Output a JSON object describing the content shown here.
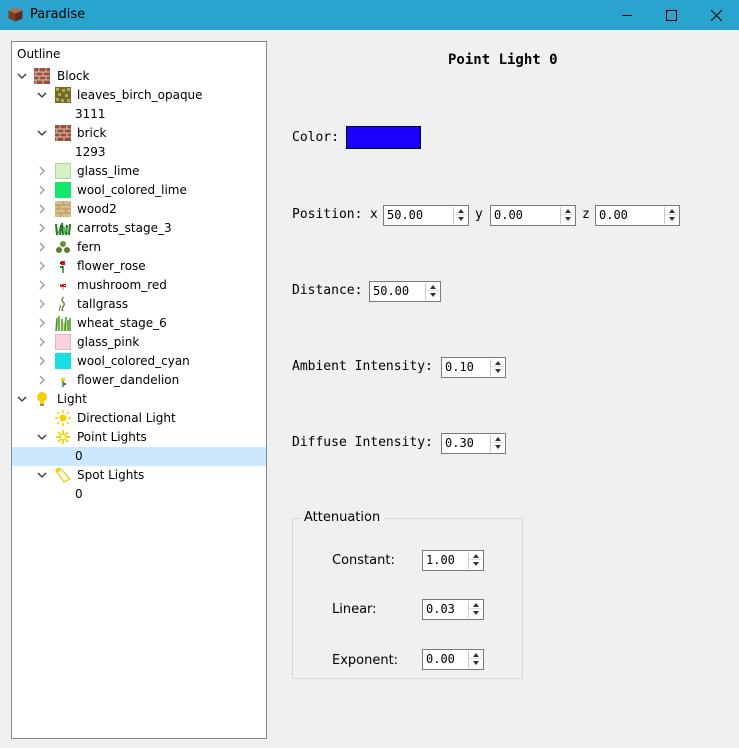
{
  "window": {
    "title": "Paradise"
  },
  "tree": {
    "header": "Outline",
    "rows": [
      {
        "label": "Block",
        "expanded": true,
        "icon": "brick-icon"
      },
      {
        "label": "leaves_birch_opaque",
        "expanded": true,
        "icon": "leaves-icon"
      },
      {
        "label": "3111"
      },
      {
        "label": "brick",
        "expanded": true,
        "icon": "brick-icon"
      },
      {
        "label": "1293"
      },
      {
        "label": "glass_lime",
        "expanded": false,
        "icon": "glass-lime-icon",
        "color": "#d9f0c2"
      },
      {
        "label": "wool_colored_lime",
        "expanded": false,
        "icon": "wool-lime-icon",
        "color": "#11e86a"
      },
      {
        "label": "wood2",
        "expanded": false,
        "icon": "wood-icon"
      },
      {
        "label": "carrots_stage_3",
        "expanded": false,
        "icon": "carrots-icon"
      },
      {
        "label": "fern",
        "expanded": false,
        "icon": "fern-icon"
      },
      {
        "label": "flower_rose",
        "expanded": false,
        "icon": "rose-icon"
      },
      {
        "label": "mushroom_red",
        "expanded": false,
        "icon": "mushroom-icon"
      },
      {
        "label": "tallgrass",
        "expanded": false,
        "icon": "tallgrass-icon"
      },
      {
        "label": "wheat_stage_6",
        "expanded": false,
        "icon": "wheat-icon"
      },
      {
        "label": "glass_pink",
        "expanded": false,
        "icon": "glass-pink-icon",
        "color": "#f9d2de"
      },
      {
        "label": "wool_colored_cyan",
        "expanded": false,
        "icon": "wool-cyan-icon",
        "color": "#16dfe5"
      },
      {
        "label": "flower_dandelion",
        "expanded": false,
        "icon": "dandelion-icon"
      },
      {
        "label": "Light",
        "expanded": true,
        "icon": "lightbulb-icon"
      },
      {
        "label": "Directional Light",
        "icon": "sun-icon"
      },
      {
        "label": "Point Lights",
        "expanded": true,
        "icon": "point-light-icon"
      },
      {
        "label": "0",
        "selected": true
      },
      {
        "label": "Spot Lights",
        "expanded": true,
        "icon": "spotlight-icon"
      },
      {
        "label": "0"
      }
    ]
  },
  "panel": {
    "title": "Point Light 0",
    "color_label": "Color:",
    "color_value": "#1a00ff",
    "position_label": "Position:",
    "x_label": "x",
    "y_label": "y",
    "z_label": "z",
    "x_value": "50.00",
    "y_value": "0.00",
    "z_value": "0.00",
    "distance_label": "Distance:",
    "distance_value": "50.00",
    "ambient_label": "Ambient Intensity:",
    "ambient_value": "0.10",
    "diffuse_label": "Diffuse Intensity:",
    "diffuse_value": "0.30",
    "attenuation": {
      "title": "Attenuation",
      "constant_label": "Constant:",
      "constant_value": "1.00",
      "linear_label": "Linear:",
      "linear_value": "0.03",
      "exponent_label": "Exponent:",
      "exponent_value": "0.00"
    }
  }
}
